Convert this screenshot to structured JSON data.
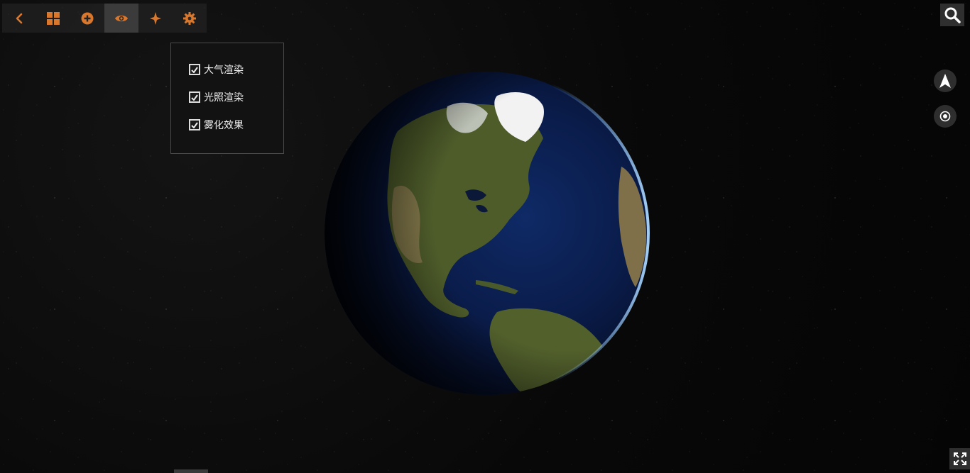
{
  "toolbar": {
    "buttons": [
      {
        "icon": "chevron-left-icon"
      },
      {
        "icon": "grid-icon"
      },
      {
        "icon": "plus-circle-icon"
      },
      {
        "icon": "eye-icon",
        "active": true
      },
      {
        "icon": "sparkle-icon"
      },
      {
        "icon": "gear-icon"
      }
    ],
    "accent_color": "#d9782d"
  },
  "effects_panel": {
    "options": [
      {
        "label": "大气渲染",
        "checked": true
      },
      {
        "label": "光照渲染",
        "checked": true
      },
      {
        "label": "雾化效果",
        "checked": true
      }
    ]
  },
  "controls": {
    "search": {
      "icon": "search-icon"
    },
    "compass": {
      "icon": "north-arrow-icon"
    },
    "locate": {
      "icon": "locate-icon"
    },
    "fullscreen": {
      "icon": "fullscreen-icon"
    }
  }
}
